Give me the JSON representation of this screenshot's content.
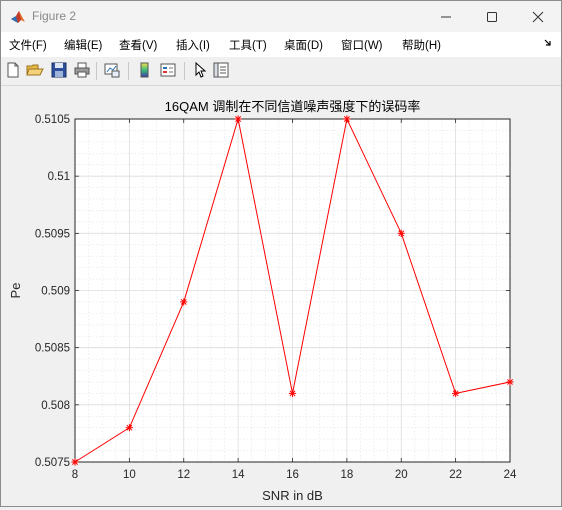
{
  "window": {
    "title": "Figure 2"
  },
  "icons": {
    "app": "matlab-logo-icon",
    "minimize": "minimize-icon",
    "maximize": "maximize-icon",
    "close": "close-icon"
  },
  "menu": {
    "items": [
      "文件(F)",
      "编辑(E)",
      "查看(V)",
      "插入(I)",
      "工具(T)",
      "桌面(D)",
      "窗口(W)",
      "帮助(H)"
    ],
    "overflow_icon": "menu-overflow-arrow-icon"
  },
  "toolbar": {
    "buttons": [
      "new-figure-icon",
      "open-file-icon",
      "save-icon",
      "print-icon",
      "link-plot-icon",
      "insert-colorbar-icon",
      "insert-legend-icon",
      "edit-plot-pointer-icon",
      "property-inspector-icon"
    ]
  },
  "chart_data": {
    "type": "line",
    "title": "16QAM 调制在不同信道噪声强度下的误码率",
    "xlabel": "SNR in dB",
    "ylabel": "Pe",
    "x": [
      8,
      10,
      12,
      14,
      16,
      18,
      20,
      22,
      24
    ],
    "series": [
      {
        "values": [
          0.5075,
          0.5078,
          0.5089,
          0.5105,
          0.5081,
          0.5105,
          0.5095,
          0.5081,
          0.5082
        ],
        "color": "#ff0000",
        "marker": "asterisk"
      }
    ],
    "xlim": [
      8,
      24
    ],
    "ylim": [
      0.5075,
      0.5105
    ],
    "xticks": [
      8,
      10,
      12,
      14,
      16,
      18,
      20,
      22,
      24
    ],
    "xtick_labels": [
      "8",
      "10",
      "12",
      "14",
      "16",
      "18",
      "20",
      "22",
      "24"
    ],
    "yticks": [
      0.5075,
      0.508,
      0.5085,
      0.509,
      0.5095,
      0.51,
      0.5105
    ],
    "ytick_labels": [
      "0.5075",
      "0.508",
      "0.5085",
      "0.509",
      "0.5095",
      "0.51",
      "0.5105"
    ],
    "grid": true,
    "minor_grid": true
  }
}
